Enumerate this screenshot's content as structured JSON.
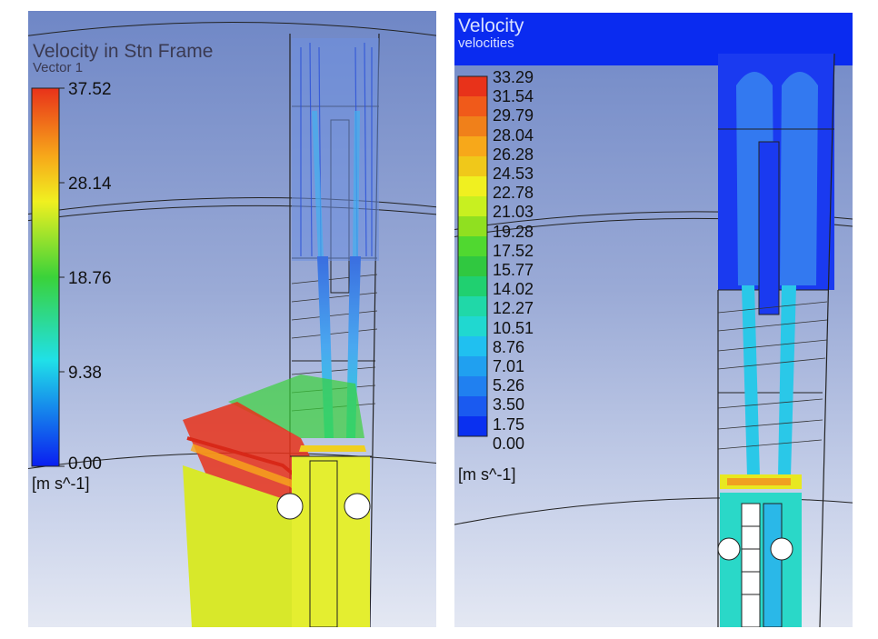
{
  "left_panel": {
    "title": "Velocity in Stn Frame",
    "subtitle": "Vector 1",
    "legend": {
      "max": "37.52",
      "mid_high": "28.14",
      "mid": "18.76",
      "mid_low": "9.38",
      "min": "0.00"
    },
    "unit": "[m s^-1]"
  },
  "right_panel": {
    "title": "Velocity",
    "subtitle": "velocities",
    "legend_levels": [
      "33.29",
      "31.54",
      "29.79",
      "28.04",
      "26.28",
      "24.53",
      "22.78",
      "21.03",
      "19.28",
      "17.52",
      "15.77",
      "14.02",
      "12.27",
      "10.51",
      "8.76",
      "7.01",
      "5.26",
      "3.50",
      "1.75",
      "0.00"
    ],
    "unit": "[m s^-1]"
  },
  "colors": {
    "background_top": "#6f87c6",
    "background_bottom": "#e4e8f3",
    "max_color": "#e8321a",
    "min_color": "#0a1ef0"
  }
}
